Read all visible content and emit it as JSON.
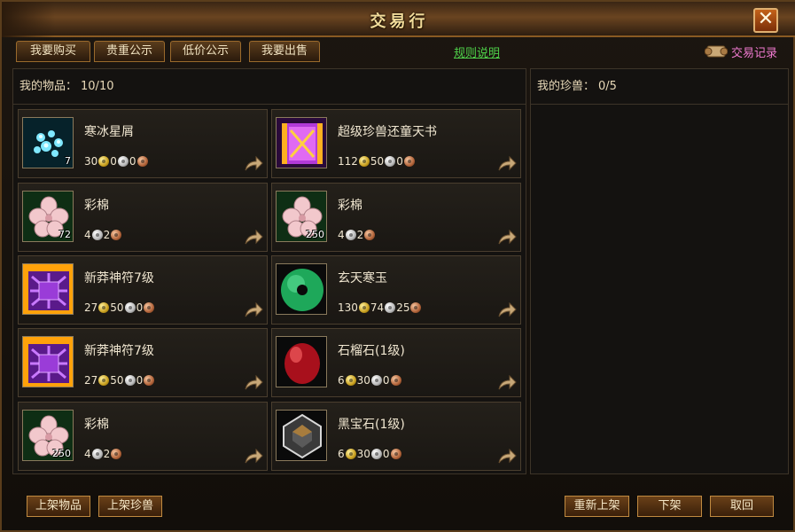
{
  "window": {
    "title": "交易行",
    "close_icon": "✕"
  },
  "tabs": [
    "我要购买",
    "贵重公示",
    "低价公示",
    "我要出售"
  ],
  "rules_link": "规则说明",
  "trade_record": "交易记录",
  "my_items": {
    "label": "我的物品：",
    "count": "10/10"
  },
  "my_pets": {
    "label": "我的珍兽：",
    "count": "0/5"
  },
  "items": [
    {
      "name": "寒冰星屑",
      "qty": "7",
      "icon": "ice-stardust-icon",
      "price": [
        {
          "v": "30",
          "c": "gold"
        },
        {
          "v": "0",
          "c": "silver"
        },
        {
          "v": "0",
          "c": "copper"
        }
      ]
    },
    {
      "name": "超级珍兽还童天书",
      "qty": "",
      "icon": "pet-rejuvenation-book-icon",
      "price": [
        {
          "v": "112",
          "c": "gold"
        },
        {
          "v": "50",
          "c": "silver"
        },
        {
          "v": "0",
          "c": "copper"
        }
      ]
    },
    {
      "name": "彩棉",
      "qty": "72",
      "icon": "cotton-flower-icon",
      "price": [
        {
          "v": "4",
          "c": "silver"
        },
        {
          "v": "2",
          "c": "copper"
        }
      ]
    },
    {
      "name": "彩棉",
      "qty": "250",
      "icon": "cotton-flower-icon",
      "price": [
        {
          "v": "4",
          "c": "silver"
        },
        {
          "v": "2",
          "c": "copper"
        }
      ]
    },
    {
      "name": "新莽神符7级",
      "qty": "",
      "icon": "xinmang-talisman-icon",
      "price": [
        {
          "v": "27",
          "c": "gold"
        },
        {
          "v": "50",
          "c": "silver"
        },
        {
          "v": "0",
          "c": "copper"
        }
      ]
    },
    {
      "name": "玄天寒玉",
      "qty": "",
      "icon": "jade-disc-icon",
      "price": [
        {
          "v": "130",
          "c": "gold"
        },
        {
          "v": "74",
          "c": "silver"
        },
        {
          "v": "25",
          "c": "copper"
        }
      ]
    },
    {
      "name": "新莽神符7级",
      "qty": "",
      "icon": "xinmang-talisman-icon",
      "price": [
        {
          "v": "27",
          "c": "gold"
        },
        {
          "v": "50",
          "c": "silver"
        },
        {
          "v": "0",
          "c": "copper"
        }
      ]
    },
    {
      "name": "石榴石(1级)",
      "qty": "",
      "icon": "garnet-gem-icon",
      "price": [
        {
          "v": "6",
          "c": "gold"
        },
        {
          "v": "30",
          "c": "silver"
        },
        {
          "v": "0",
          "c": "copper"
        }
      ]
    },
    {
      "name": "彩棉",
      "qty": "250",
      "icon": "cotton-flower-icon",
      "price": [
        {
          "v": "4",
          "c": "silver"
        },
        {
          "v": "2",
          "c": "copper"
        }
      ]
    },
    {
      "name": "黑宝石(1级)",
      "qty": "",
      "icon": "black-gem-icon",
      "price": [
        {
          "v": "6",
          "c": "gold"
        },
        {
          "v": "30",
          "c": "silver"
        },
        {
          "v": "0",
          "c": "copper"
        }
      ]
    }
  ],
  "buttons": {
    "list_item": "上架物品",
    "list_pet": "上架珍兽",
    "relist": "重新上架",
    "delist": "下架",
    "cancel": "取回"
  },
  "colors": {
    "gold_text": "#f2dc9a",
    "link_green": "#4fd24a",
    "record_pink": "#f07ad0"
  }
}
